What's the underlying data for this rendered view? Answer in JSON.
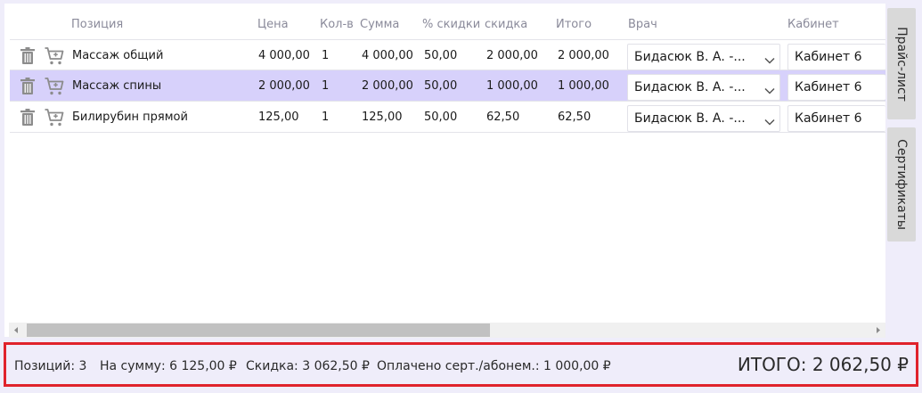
{
  "columns": {
    "position": "Позиция",
    "price": "Цена",
    "qty": "Кол-в",
    "sum": "Сумма",
    "discount_pct": "% скидки",
    "discount": "скидка",
    "total": "Итого",
    "doctor": "Врач",
    "cabinet": "Кабинет"
  },
  "rows": [
    {
      "name": "Массаж общий",
      "price": "4 000,00",
      "qty": "1",
      "sum": "4 000,00",
      "discount_pct": "50,00",
      "discount": "2 000,00",
      "total": "2 000,00",
      "doctor": "Бидасюк В. А. -...",
      "cabinet": "Кабинет 6",
      "selected": false
    },
    {
      "name": "Массаж спины",
      "price": "2 000,00",
      "qty": "1",
      "sum": "2 000,00",
      "discount_pct": "50,00",
      "discount": "1 000,00",
      "total": "1 000,00",
      "doctor": "Бидасюк В. А. -...",
      "cabinet": "Кабинет 6",
      "selected": true
    },
    {
      "name": "Билирубин прямой",
      "price": "125,00",
      "qty": "1",
      "sum": "125,00",
      "discount_pct": "50,00",
      "discount": "62,50",
      "total": "62,50",
      "doctor": "Бидасюк В. А. -...",
      "cabinet": "Кабинет 6",
      "selected": false
    }
  ],
  "icons": {
    "delete": "trash-icon",
    "cart": "cart-icon",
    "dropdown": "chevron-down-icon"
  },
  "side_tabs": {
    "price_list": "Прайс-лист",
    "certificates": "Сертификаты"
  },
  "footer": {
    "positions": "Позиций: 3",
    "sum": "На сумму: 6 125,00 ₽",
    "discount": "Скидка: 3 062,50 ₽",
    "paid_cert": "Оплачено серт./абонем.: 1 000,00 ₽",
    "total": "ИТОГО: 2 062,50 ₽"
  },
  "colors": {
    "selected_row": "#d7d1fb",
    "footer_border": "#e0232b",
    "background": "#efedfa"
  }
}
